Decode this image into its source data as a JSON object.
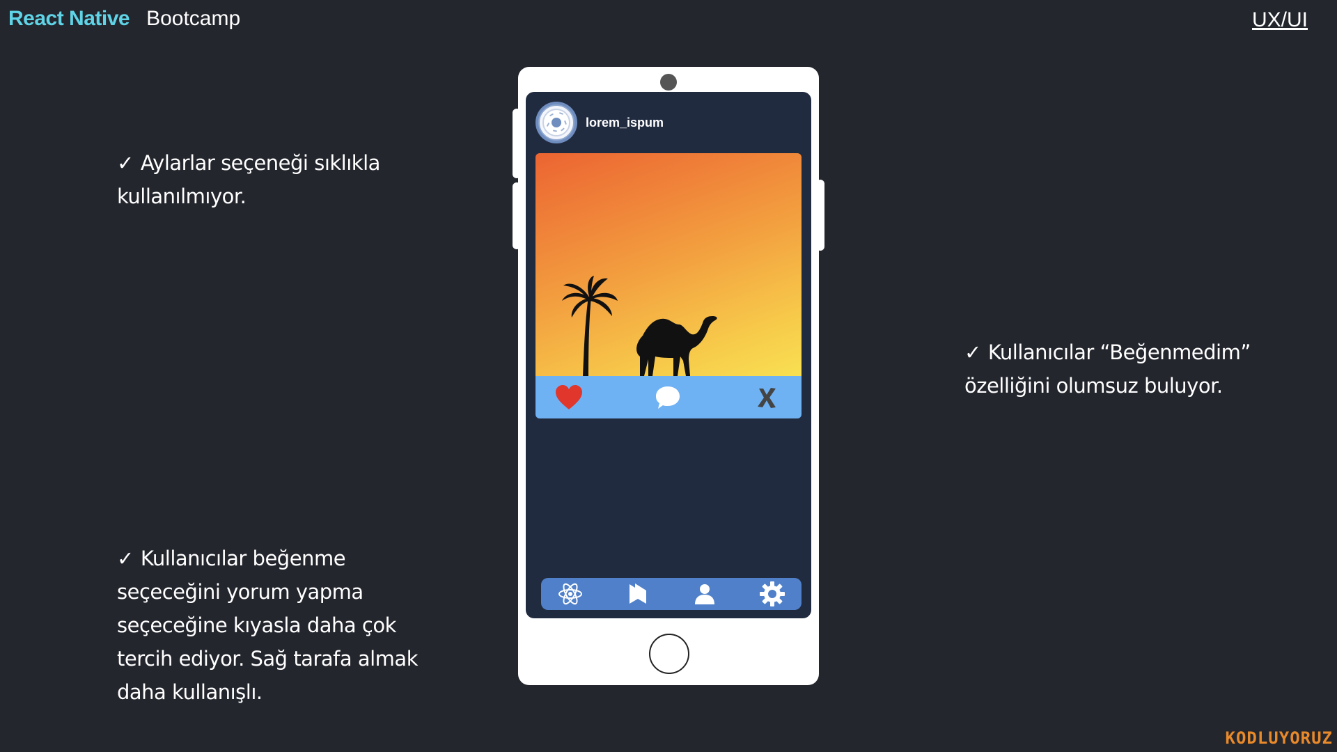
{
  "header": {
    "brand_primary": "React Native",
    "brand_secondary": "Bootcamp",
    "section": "UX/UI"
  },
  "notes": [
    {
      "check": "✓",
      "text": "Aylarlar seçeneği sıklıkla kullanılmıyor."
    },
    {
      "check": "✓",
      "text": "Kullanıcılar “Beğenmedim” özelliğini olumsuz buluyor."
    },
    {
      "check": "✓",
      "text": "Kullanıcılar beğenme seçeceğini yorum yapma seçeceğine kıyasla daha çok tercih ediyor. Sağ tarafa almak daha kullanışlı."
    }
  ],
  "phone": {
    "username": "lorem_ispum",
    "post_actions": [
      "heart-icon",
      "comment-icon",
      "dislike-x-icon"
    ],
    "tabs": [
      "react-atom-icon",
      "bookmark-icon",
      "user-icon",
      "gear-icon"
    ]
  },
  "footer": {
    "logo": "KODLUYORUZ"
  },
  "colors": {
    "background": "#24262e",
    "brand_accent": "#5fd4e6",
    "screen": "#212b40",
    "action_bar": "#6eb2f4",
    "tab_bar": "#4f80c9",
    "like_red": "#e0362c",
    "logo_orange": "#e8892a"
  }
}
